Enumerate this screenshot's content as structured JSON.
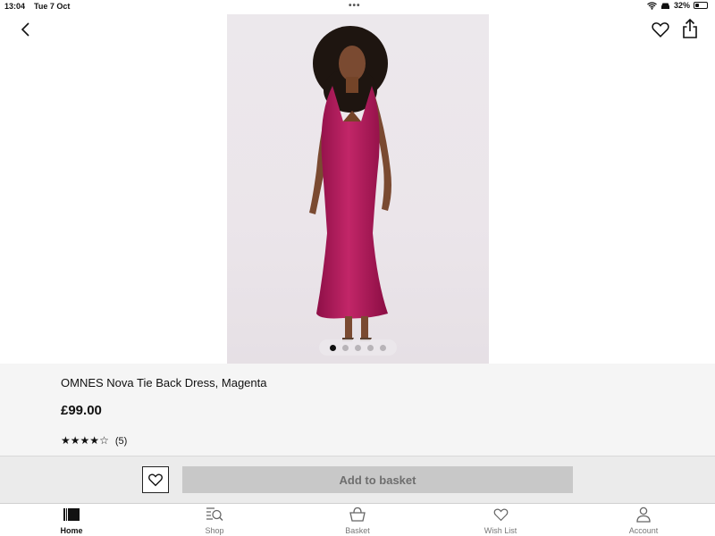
{
  "status_bar": {
    "time": "13:04",
    "date": "Tue 7 Oct",
    "battery_text": "32%",
    "battery_level": 0.32
  },
  "product": {
    "title": "OMNES Nova Tie Back Dress, Magenta",
    "price": "£99.00",
    "rating": 4,
    "rating_max": 5,
    "review_count": "(5)",
    "image_count": 5,
    "active_image": 1,
    "dress_color": "#b01a5c"
  },
  "actions": {
    "add_to_basket_label": "Add to basket"
  },
  "tabs": [
    {
      "label": "Home",
      "icon": "home-icon",
      "active": true
    },
    {
      "label": "Shop",
      "icon": "shop-search-icon",
      "active": false
    },
    {
      "label": "Basket",
      "icon": "basket-icon",
      "active": false
    },
    {
      "label": "Wish List",
      "icon": "heart-icon",
      "active": false
    },
    {
      "label": "Account",
      "icon": "account-icon",
      "active": false
    }
  ]
}
